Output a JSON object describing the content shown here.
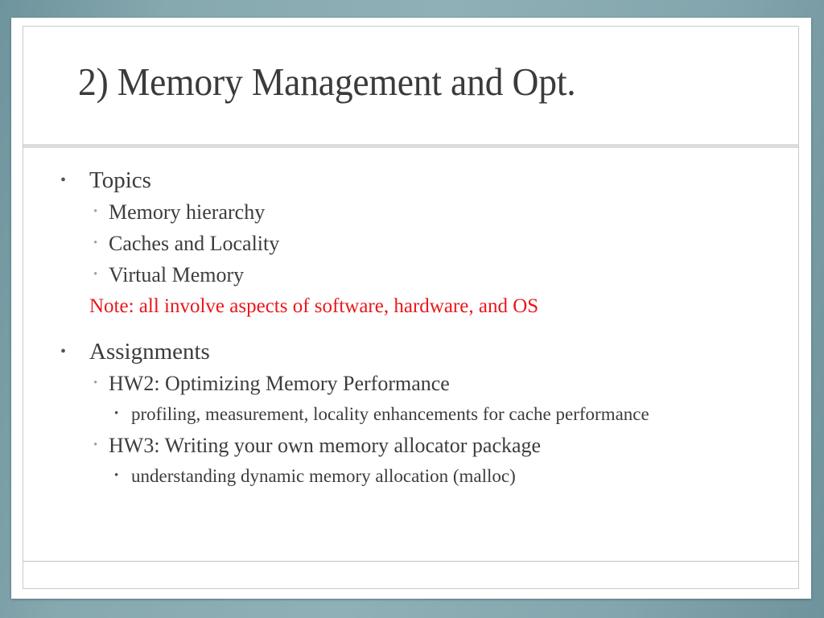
{
  "theme": {
    "background_color": "#86a8af",
    "slide_background": "#ffffff",
    "title_color": "#3b3b3b",
    "body_color": "#3d3d3d",
    "accent_red": "#e8181c",
    "divider_color": "#dcdcdc",
    "border_color": "#c9c9c9"
  },
  "slide": {
    "title": "2) Memory Management and Opt.",
    "bullet_glyph": "•",
    "body": [
      {
        "level": 1,
        "text": "Topics"
      },
      {
        "level": 2,
        "text": "Memory hierarchy"
      },
      {
        "level": 2,
        "text": "Caches and Locality"
      },
      {
        "level": 2,
        "text": "Virtual Memory"
      },
      {
        "level": 0,
        "text": "Note: all involve aspects of software, hardware, and OS",
        "style": "note-red"
      },
      {
        "level": 1,
        "text": "Assignments"
      },
      {
        "level": 2,
        "text": "HW2: Optimizing Memory Performance"
      },
      {
        "level": 3,
        "text": "profiling, measurement, locality enhancements for cache performance"
      },
      {
        "level": 2,
        "text": "HW3: Writing your own memory allocator package"
      },
      {
        "level": 3,
        "text": "understanding dynamic memory allocation (malloc)"
      }
    ],
    "footer": ""
  }
}
